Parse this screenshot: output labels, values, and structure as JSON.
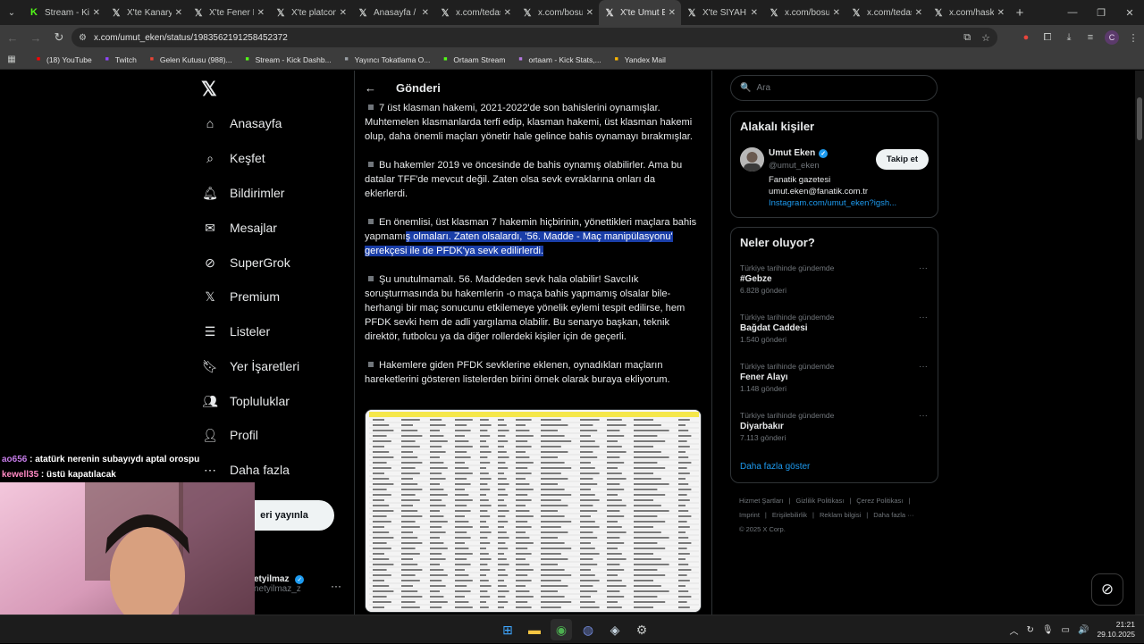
{
  "browser": {
    "tabs": [
      {
        "title": "Stream - Kick",
        "icon": "kick-icon",
        "active": false
      },
      {
        "title": "X'te Kanarya",
        "icon": "x-icon",
        "active": false
      },
      {
        "title": "X'te Fener M",
        "icon": "x-icon",
        "active": false
      },
      {
        "title": "X'te platcom",
        "icon": "x-icon",
        "active": false
      },
      {
        "title": "Anasayfa / X",
        "icon": "x-icon",
        "active": false
      },
      {
        "title": "x.com/tedas",
        "icon": "x-icon",
        "active": false
      },
      {
        "title": "x.com/bosun",
        "icon": "x-icon",
        "active": false
      },
      {
        "title": "X'te Umut Ek",
        "icon": "x-icon",
        "active": true
      },
      {
        "title": "X'te SİYAH S",
        "icon": "x-icon",
        "active": false
      },
      {
        "title": "x.com/bosun",
        "icon": "x-icon",
        "active": false
      },
      {
        "title": "x.com/tedas",
        "icon": "x-icon",
        "active": false
      },
      {
        "title": "x.com/hasku",
        "icon": "x-icon",
        "active": false
      }
    ],
    "url": "x.com/umut_eken/status/1983562191258452372",
    "bookmarks": [
      {
        "label": "(18) YouTube",
        "icon": "youtube-icon",
        "color": "#ff0000"
      },
      {
        "label": "Twitch",
        "icon": "twitch-icon",
        "color": "#9146ff"
      },
      {
        "label": "Gelen Kutusu (988)...",
        "icon": "gmail-icon",
        "color": "#ea4335"
      },
      {
        "label": "Stream - Kick Dashb...",
        "icon": "kick-icon",
        "color": "#53fc18"
      },
      {
        "label": "Yayıncı Tokatlama O...",
        "icon": "globe-icon",
        "color": "#9aa0a6"
      },
      {
        "label": "Ortaam Stream",
        "icon": "kick-icon",
        "color": "#53fc18"
      },
      {
        "label": "ortaam - Kick Stats,...",
        "icon": "stats-icon",
        "color": "#b478e0"
      },
      {
        "label": "Yandex Mail",
        "icon": "mail-icon",
        "color": "#ffb800"
      }
    ]
  },
  "sidebar": {
    "items": [
      {
        "label": "Anasayfa",
        "icon": "home-icon"
      },
      {
        "label": "Keşfet",
        "icon": "search-icon"
      },
      {
        "label": "Bildirimler",
        "icon": "bell-icon"
      },
      {
        "label": "Mesajlar",
        "icon": "mail-icon"
      },
      {
        "label": "SuperGrok",
        "icon": "grok-icon"
      },
      {
        "label": "Premium",
        "icon": "x-icon"
      },
      {
        "label": "Listeler",
        "icon": "list-icon"
      },
      {
        "label": "Yer İşaretleri",
        "icon": "bookmark-icon"
      },
      {
        "label": "Topluluklar",
        "icon": "communities-icon"
      },
      {
        "label": "Profil",
        "icon": "profile-icon"
      },
      {
        "label": "Daha fazla",
        "icon": "more-icon"
      }
    ],
    "post_button": "eri yayınla",
    "account": {
      "name": "etyilmaz",
      "handle": "netyilmaz_z"
    }
  },
  "post": {
    "header": "Gönderi",
    "paragraphs": [
      {
        "text": "7 üst klasman hakemi, 2021-2022'de son bahislerini oynamışlar. Muhtemelen klasmanlarda terfi edip, klasman hakemi, üst klasman hakemi olup, daha önemli maçları yönetir hale gelince bahis oynamayı bırakmışlar.",
        "hl": ""
      },
      {
        "text": "Bu hakemler 2019 ve öncesinde de bahis oynamış olabilirler. Ama bu datalar TFF'de mevcut değil. Zaten olsa sevk evraklarına onları da eklerlerdi.",
        "hl": ""
      },
      {
        "text": "En önemlisi, üst klasman 7 hakemin hiçbirinin, yönettikleri maçlara bahis yapmamı",
        "hl": "ş olmaları. Zaten olsalardı, '56. Madde - Maç manipülasyonu' gerekçesi ile de PFDK'ya sevk edilirlerdi."
      },
      {
        "text": "Şu unutulmamalı. 56. Maddeden sevk hala olabilir! Savcılık soruşturmasında bu hakemlerin -o maça bahis yapmamış olsalar bile- herhangi bir maç sonucunu etkilemeye yönelik eylemi tespit edilirse, hem PFDK sevki hem de adli yargılama olabilir. Bu senaryo başkan, teknik direktör, futbolcu ya da diğer rollerdeki kişiler için de geçerli.",
        "hl": ""
      },
      {
        "text": "Hakemlere giden PFDK sevklerine eklenen, oynadıkları maçların hareketlerini gösteren listelerden birini örnek olarak buraya ekliyorum.",
        "hl": ""
      }
    ]
  },
  "right": {
    "search_placeholder": "Ara",
    "related": {
      "title": "Alakalı kişiler",
      "name": "Umut Eken",
      "handle": "@umut_eken",
      "follow": "Takip et",
      "bio_line1": "Fanatik gazetesi",
      "bio_line2": "umut.eken@fanatik.com.tr",
      "bio_link": "Instagram.com/umut_eken?igsh..."
    },
    "trends": {
      "title": "Neler oluyor?",
      "items": [
        {
          "context": "Türkiye tarihinde gündemde",
          "name": "#Gebze",
          "count": "6.828 gönderi"
        },
        {
          "context": "Türkiye tarihinde gündemde",
          "name": "Bağdat Caddesi",
          "count": "1.540 gönderi"
        },
        {
          "context": "Türkiye tarihinde gündemde",
          "name": "Fener Alayı",
          "count": "1.148 gönderi"
        },
        {
          "context": "Türkiye tarihinde gündemde",
          "name": "Diyarbakır",
          "count": "7.113 gönderi"
        }
      ],
      "show_more": "Daha fazla göster"
    },
    "footer": [
      "Hizmet Şartları",
      "|",
      "Gizlilik Politikası",
      "|",
      "Çerez Politikası",
      "|",
      "Imprint",
      "|",
      "Erişilebilirlik",
      "|",
      "Reklam bilgisi",
      "|",
      "Daha fazla ···",
      "© 2025 X Corp."
    ]
  },
  "stream": {
    "chat": [
      {
        "user": "ao656",
        "message": "atatürk nerenin subayıydı aptal orospu",
        "color": "#c57ce8"
      },
      {
        "user": "kewell35",
        "message": "üstü kapatılacak",
        "color": "#ff8ac3"
      }
    ]
  },
  "taskbar": {
    "time": "21:21",
    "date": "29.10.2025",
    "icons": [
      "windows-start-icon",
      "file-explorer-icon",
      "chrome-icon",
      "discord-icon",
      "steam-icon",
      "settings-icon"
    ]
  },
  "colors": {
    "accent": "#1d9bf0",
    "highlight": "#1a3ea8",
    "background": "#000000",
    "border": "#2f3336",
    "muted": "#71767b"
  }
}
